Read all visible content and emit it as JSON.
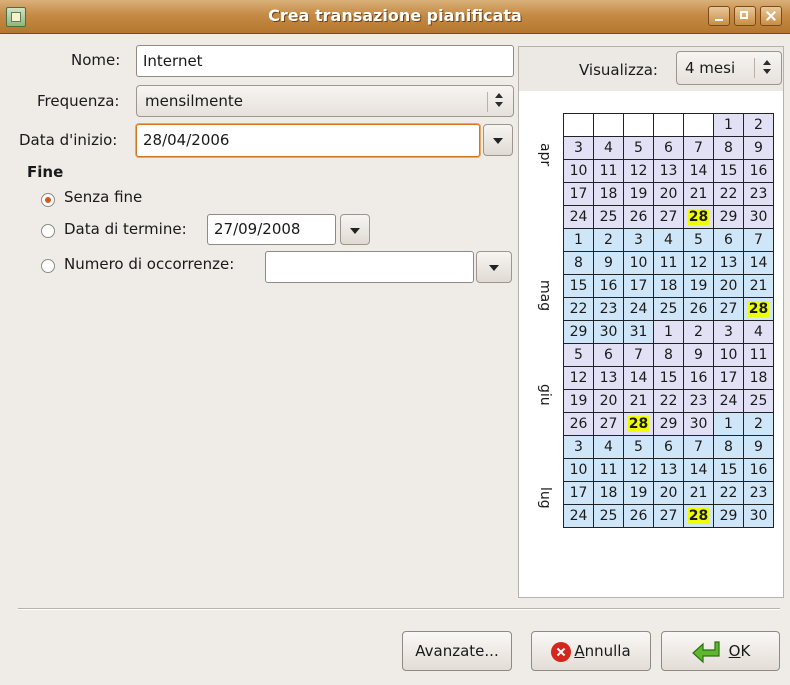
{
  "window": {
    "title": "Crea transazione pianificata"
  },
  "form": {
    "name_label": "Nome:",
    "name_value": "Internet",
    "frequency_label": "Frequenza:",
    "frequency_value": "mensilmente",
    "start_label": "Data d'inizio:",
    "start_value": "28/04/2006",
    "end_section_title": "Fine",
    "end_options": {
      "never": "Senza fine",
      "end_date": "Data di termine:",
      "occurrences": "Numero di occorrenze:"
    },
    "selected_end_option": "never",
    "end_date_value": "27/09/2008",
    "occurrences_value": ""
  },
  "calendar": {
    "view_label": "Visualizza:",
    "view_value": "4 mesi",
    "month_labels": [
      "apr",
      "mag",
      "giu",
      "lug"
    ],
    "rows": [
      [
        "",
        "",
        "",
        "",
        "",
        "1",
        "2"
      ],
      [
        "3",
        "4",
        "5",
        "6",
        "7",
        "8",
        "9"
      ],
      [
        "10",
        "11",
        "12",
        "13",
        "14",
        "15",
        "16"
      ],
      [
        "17",
        "18",
        "19",
        "20",
        "21",
        "22",
        "23"
      ],
      [
        "24",
        "25",
        "26",
        "27",
        "28",
        "29",
        "30"
      ],
      [
        "1",
        "2",
        "3",
        "4",
        "5",
        "6",
        "7"
      ],
      [
        "8",
        "9",
        "10",
        "11",
        "12",
        "13",
        "14"
      ],
      [
        "15",
        "16",
        "17",
        "18",
        "19",
        "20",
        "21"
      ],
      [
        "22",
        "23",
        "24",
        "25",
        "26",
        "27",
        "28"
      ],
      [
        "29",
        "30",
        "31",
        "1",
        "2",
        "3",
        "4"
      ],
      [
        "5",
        "6",
        "7",
        "8",
        "9",
        "10",
        "11"
      ],
      [
        "12",
        "13",
        "14",
        "15",
        "16",
        "17",
        "18"
      ],
      [
        "19",
        "20",
        "21",
        "22",
        "23",
        "24",
        "25"
      ],
      [
        "26",
        "27",
        "28",
        "29",
        "30",
        "1",
        "2"
      ],
      [
        "3",
        "4",
        "5",
        "6",
        "7",
        "8",
        "9"
      ],
      [
        "10",
        "11",
        "12",
        "13",
        "14",
        "15",
        "16"
      ],
      [
        "17",
        "18",
        "19",
        "20",
        "21",
        "22",
        "23"
      ],
      [
        "24",
        "25",
        "26",
        "27",
        "28",
        "29",
        "30"
      ]
    ],
    "highlighted_dates": [
      "28/04",
      "28/05",
      "28/06",
      "28/07"
    ],
    "colors": {
      "month_a": "#e2e0f4",
      "month_b": "#cfe6f8",
      "highlight": "#f0ff00"
    }
  },
  "buttons": {
    "advanced": "Avanzate...",
    "cancel_pre": "",
    "cancel_mnemonic": "A",
    "cancel_rest": "nnulla",
    "ok_mnemonic": "O",
    "ok_rest": "K"
  },
  "icons": [
    "app-icon",
    "cancel-icon",
    "ok-arrow-icon",
    "dropdown-arrow-icon",
    "spin-updown-icon"
  ]
}
